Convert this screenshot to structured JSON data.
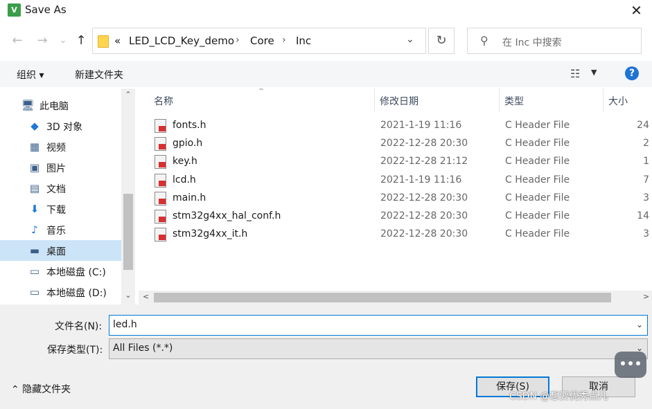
{
  "window": {
    "title": "Save As",
    "app_icon": "V",
    "close": "✕"
  },
  "nav": {
    "back": "←",
    "forward": "→",
    "recent": "⌄",
    "up": "↑",
    "breadcrumb_overflow": "«",
    "breadcrumbs": [
      "LED_LCD_Key_demo",
      "Core",
      "Inc"
    ],
    "separator": "›",
    "dropdown": "⌄",
    "refresh": "↻",
    "search_placeholder": "在 Inc 中搜索"
  },
  "toolbar": {
    "organize": "组织 ▾",
    "new_folder": "新建文件夹",
    "view_icon": "☷",
    "view_dropdown": "▼",
    "help": "?"
  },
  "sidebar": {
    "items": [
      {
        "label": "此电脑",
        "icon": "🖥",
        "selected": false,
        "root": true
      },
      {
        "label": "3D 对象",
        "icon": "◆",
        "selected": false
      },
      {
        "label": "视频",
        "icon": "▦",
        "selected": false
      },
      {
        "label": "图片",
        "icon": "▣",
        "selected": false
      },
      {
        "label": "文档",
        "icon": "▤",
        "selected": false
      },
      {
        "label": "下载",
        "icon": "⬇",
        "selected": false
      },
      {
        "label": "音乐",
        "icon": "♪",
        "selected": false
      },
      {
        "label": "桌面",
        "icon": "▬",
        "selected": true
      },
      {
        "label": "本地磁盘 (C:)",
        "icon": "▭",
        "selected": false
      },
      {
        "label": "本地磁盘 (D:)",
        "icon": "▭",
        "selected": false
      }
    ],
    "scroll_up": "⌃",
    "scroll_down": "⌄"
  },
  "columns": {
    "name": "名称",
    "date": "修改日期",
    "type": "类型",
    "size": "大小",
    "sort_arrow": "⌃"
  },
  "files": [
    {
      "name": "fonts.h",
      "date": "2021-1-19 11:16",
      "type": "C Header File",
      "size": "24"
    },
    {
      "name": "gpio.h",
      "date": "2022-12-28 20:30",
      "type": "C Header File",
      "size": "2"
    },
    {
      "name": "key.h",
      "date": "2022-12-28 21:12",
      "type": "C Header File",
      "size": "1"
    },
    {
      "name": "lcd.h",
      "date": "2021-1-19 11:16",
      "type": "C Header File",
      "size": "7"
    },
    {
      "name": "main.h",
      "date": "2022-12-28 20:30",
      "type": "C Header File",
      "size": "3"
    },
    {
      "name": "stm32g4xx_hal_conf.h",
      "date": "2022-12-28 20:30",
      "type": "C Header File",
      "size": "14"
    },
    {
      "name": "stm32g4xx_it.h",
      "date": "2022-12-28 20:30",
      "type": "C Header File",
      "size": "3"
    }
  ],
  "hscroll": {
    "left": "<",
    "right": ">"
  },
  "form": {
    "filename_label": "文件名(N):",
    "filename_value": "led.h",
    "filetype_label": "保存类型(T):",
    "filetype_value": "All Files (*.*)",
    "dropdown": "⌄",
    "hide_folders": "⌃ 隐藏文件夹",
    "save": "保存(S)",
    "cancel": "取消"
  },
  "watermark": "CSDN @想要优秀点儿"
}
